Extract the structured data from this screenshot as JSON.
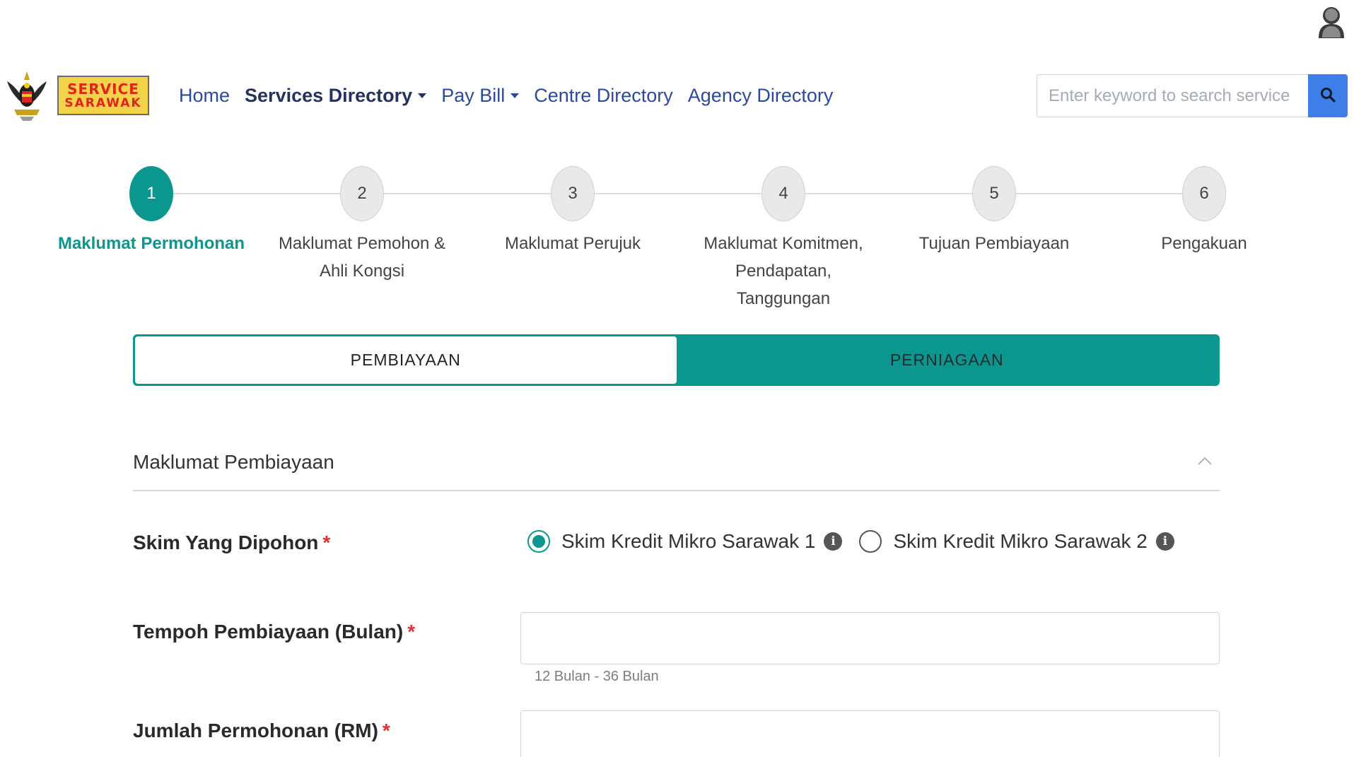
{
  "header": {
    "logo_line1": "SERVICE",
    "logo_line2": "SARAWAK"
  },
  "nav": {
    "home": "Home",
    "services_directory": "Services Directory",
    "pay_bill": "Pay Bill",
    "centre_directory": "Centre Directory",
    "agency_directory": "Agency Directory"
  },
  "search": {
    "placeholder": "Enter keyword to search service"
  },
  "stepper": {
    "steps": [
      {
        "number": "1",
        "label": "Maklumat Permohonan",
        "active": true
      },
      {
        "number": "2",
        "label": "Maklumat Pemohon & Ahli Kongsi",
        "active": false
      },
      {
        "number": "3",
        "label": "Maklumat Perujuk",
        "active": false
      },
      {
        "number": "4",
        "label": "Maklumat Komitmen, Pendapatan, Tanggungan",
        "active": false
      },
      {
        "number": "5",
        "label": "Tujuan Pembiayaan",
        "active": false
      },
      {
        "number": "6",
        "label": "Pengakuan",
        "active": false
      }
    ]
  },
  "toggle": {
    "option1": "PEMBIAYAAN",
    "option2": "PERNIAGAAN",
    "selected": "PEMBIAYAAN"
  },
  "section": {
    "title": "Maklumat Pembiayaan"
  },
  "form": {
    "required_mark": "*",
    "skim": {
      "label": "Skim Yang Dipohon",
      "options": [
        "Skim Kredit Mikro Sarawak 1",
        "Skim Kredit Mikro Sarawak 2"
      ],
      "selected": "Skim Kredit Mikro Sarawak 1"
    },
    "tempoh": {
      "label": "Tempoh Pembiayaan (Bulan)",
      "value": "",
      "hint": "12 Bulan - 36 Bulan"
    },
    "jumlah": {
      "label": "Jumlah Permohonan (RM)",
      "value": ""
    }
  },
  "colors": {
    "accent": "#0b9690",
    "nav_link": "#2b4a9b",
    "search_button": "#3e7ee8",
    "required": "#e03131"
  },
  "icons": [
    "user-avatar-icon",
    "sarawak-emblem-icon",
    "search-icon",
    "chevron-up-icon",
    "info-icon"
  ]
}
